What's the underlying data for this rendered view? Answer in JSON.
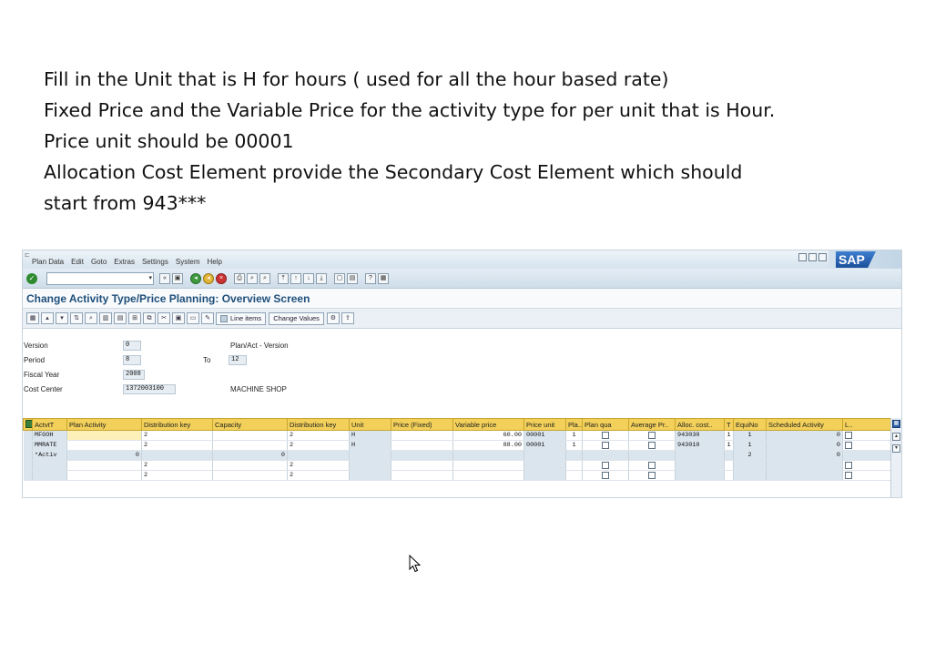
{
  "instructions": [
    "Fill in the Unit that is H for hours ( used for all the hour based rate)",
    "Fixed Price and the Variable Price for the activity type for per unit that is Hour.",
    "Price unit should be 00001",
    "Allocation Cost Element provide the Secondary Cost Element which should",
    "start from 943***"
  ],
  "menu": [
    "Plan Data",
    "Edit",
    "Goto",
    "Extras",
    "Settings",
    "System",
    "Help"
  ],
  "logo": "SAP",
  "screen_title": "Change Activity Type/Price Planning: Overview Screen",
  "app_toolbar": {
    "line_items_label": "Line items",
    "change_values_label": "Change Values"
  },
  "header": {
    "version_label": "Version",
    "version_value": "0",
    "plan_act_label": "Plan/Act - Version",
    "period_label": "Period",
    "period_from": "8",
    "to_label": "To",
    "period_to": "12",
    "fiscal_year_label": "Fiscal Year",
    "fiscal_year_value": "2008",
    "cost_center_label": "Cost Center",
    "cost_center_value": "1372003100",
    "cost_center_desc": "MACHINE SHOP"
  },
  "grid": {
    "columns": [
      "ActvtT",
      "Plan Activity",
      "Distribution key",
      "Capacity",
      "Distribution key",
      "Unit",
      "Price (Fixed)",
      "Variable price",
      "Price unit",
      "Pla..",
      "Plan qua",
      "Average Pr..",
      "Alloc. cost..",
      "T",
      "EquiNo",
      "Scheduled Activity",
      "L.."
    ],
    "rows": [
      [
        "MFGOH",
        "",
        "2",
        "",
        "2",
        "H",
        "",
        "60.00",
        "00001",
        "1",
        "",
        "",
        "943030",
        "1",
        "1",
        "0",
        ""
      ],
      [
        "MMRATE",
        "",
        "2",
        "",
        "2",
        "H",
        "",
        "88.00",
        "00001",
        "1",
        "",
        "",
        "943010",
        "1",
        "1",
        "0",
        ""
      ],
      [
        "*Activ",
        "0",
        "",
        "0",
        "",
        "",
        "",
        "",
        "",
        "",
        "",
        "",
        "",
        "",
        "2",
        "0",
        ""
      ],
      [
        "",
        "",
        "2",
        "",
        "2",
        "",
        "",
        "",
        "",
        "",
        "",
        "",
        "",
        "",
        "",
        "",
        ""
      ],
      [
        "",
        "",
        "2",
        "",
        "2",
        "",
        "",
        "",
        "",
        "",
        "",
        "",
        "",
        "",
        "",
        "",
        ""
      ]
    ]
  },
  "colors": {
    "header_yellow": "#f2d05a",
    "title_blue": "#1f4f7a",
    "menubar": "#d6e3ee"
  }
}
